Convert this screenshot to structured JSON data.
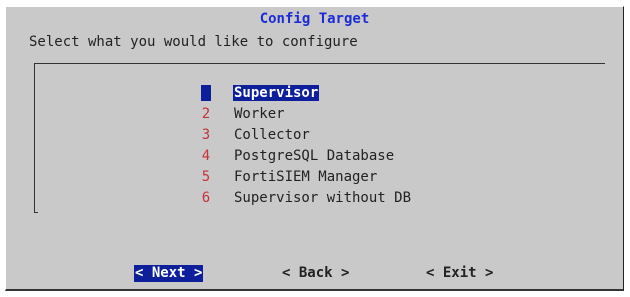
{
  "dialog": {
    "title": "Config Target",
    "prompt": "Select what you would like to configure"
  },
  "menu": {
    "items": [
      {
        "tag": "1",
        "label": "Supervisor",
        "selected": true
      },
      {
        "tag": "2",
        "label": "Worker",
        "selected": false
      },
      {
        "tag": "3",
        "label": "Collector",
        "selected": false
      },
      {
        "tag": "4",
        "label": "PostgreSQL Database",
        "selected": false
      },
      {
        "tag": "5",
        "label": "FortiSIEM Manager",
        "selected": false
      },
      {
        "tag": "6",
        "label": "Supervisor without DB",
        "selected": false
      }
    ]
  },
  "buttons": {
    "next": "< Next >",
    "back": "< Back >",
    "exit": "< Exit >"
  },
  "colors": {
    "dialog_bg": "#c9c9c9",
    "title": "#1b2bd6",
    "highlight": "#0d1f9a",
    "tag": "#c8323c"
  }
}
